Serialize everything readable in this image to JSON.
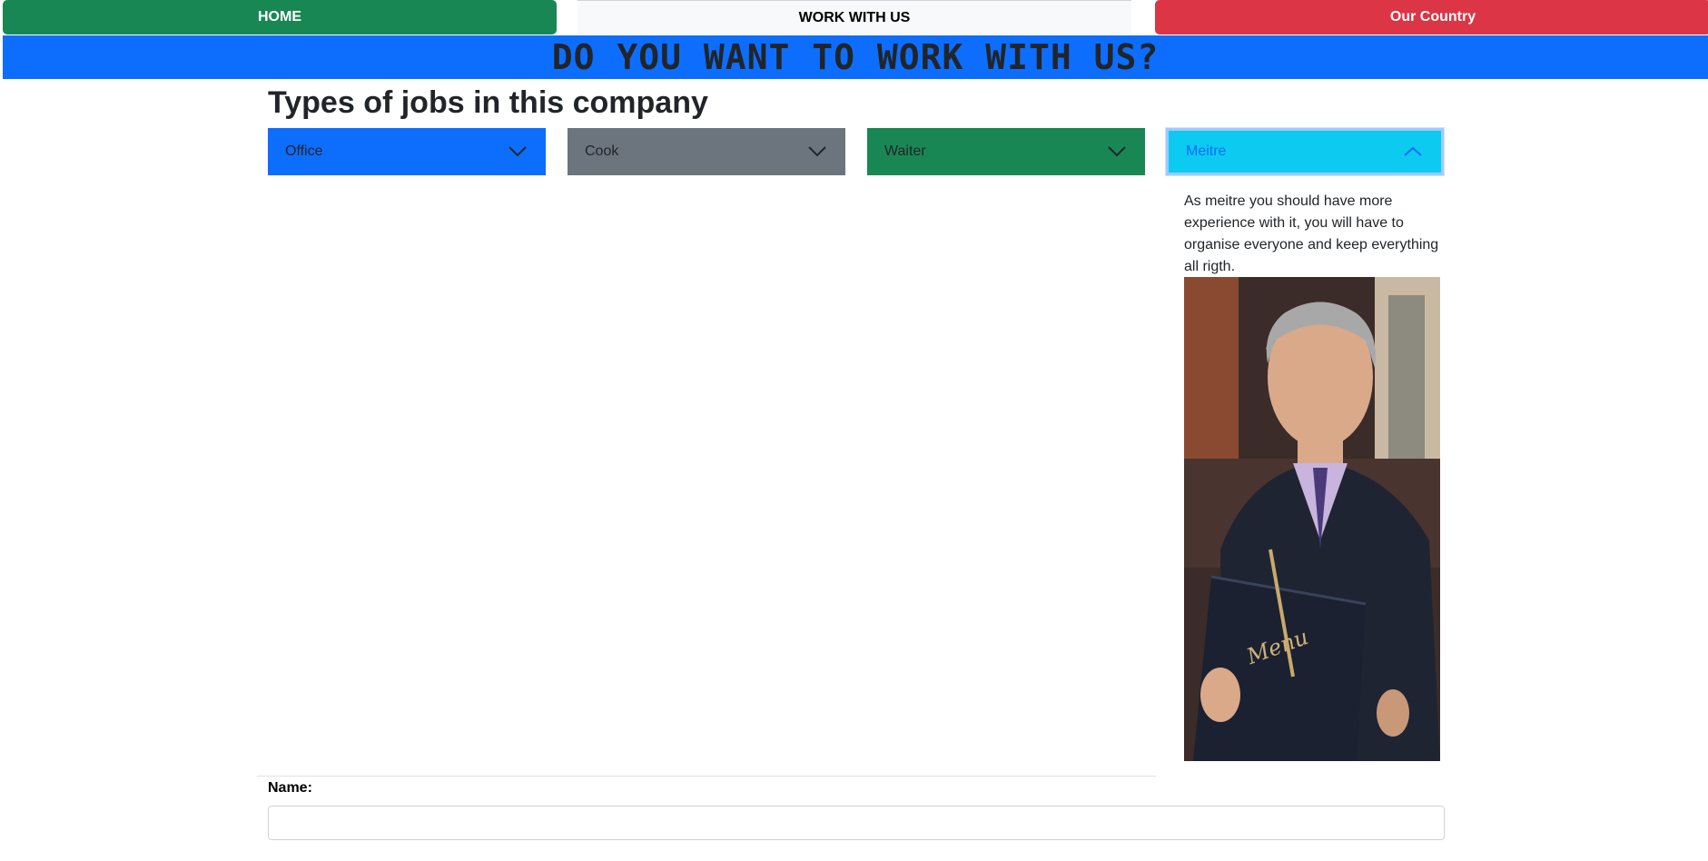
{
  "nav": {
    "home": "HOME",
    "work_with_us": "WORK WITH US",
    "our_country": "Our Country"
  },
  "banner": {
    "title": "DO YOU WANT TO WORK WITH US?"
  },
  "jobs": {
    "heading": "Types of jobs in this company",
    "items": [
      {
        "label": "Office",
        "color": "#0d6efd",
        "expanded": false,
        "icon": "chevron-down-icon"
      },
      {
        "label": "Cook",
        "color": "#6c757d",
        "expanded": false,
        "icon": "chevron-down-icon"
      },
      {
        "label": "Waiter",
        "color": "#198754",
        "expanded": false,
        "icon": "chevron-down-icon"
      },
      {
        "label": "Meitre",
        "color": "#0dcaf0",
        "expanded": true,
        "icon": "chevron-up-icon"
      }
    ],
    "meitre_description": "As meitre you should have more experience with it, you will have to organise everyone and keep everything all rigth.",
    "meitre_image_text": "Menu"
  },
  "form": {
    "name_label": "Name:",
    "name_value": "",
    "name_placeholder": ""
  },
  "colors": {
    "home": "#198754",
    "work": "#f8f9fa",
    "country": "#dc3545",
    "banner": "#0d6efd"
  }
}
